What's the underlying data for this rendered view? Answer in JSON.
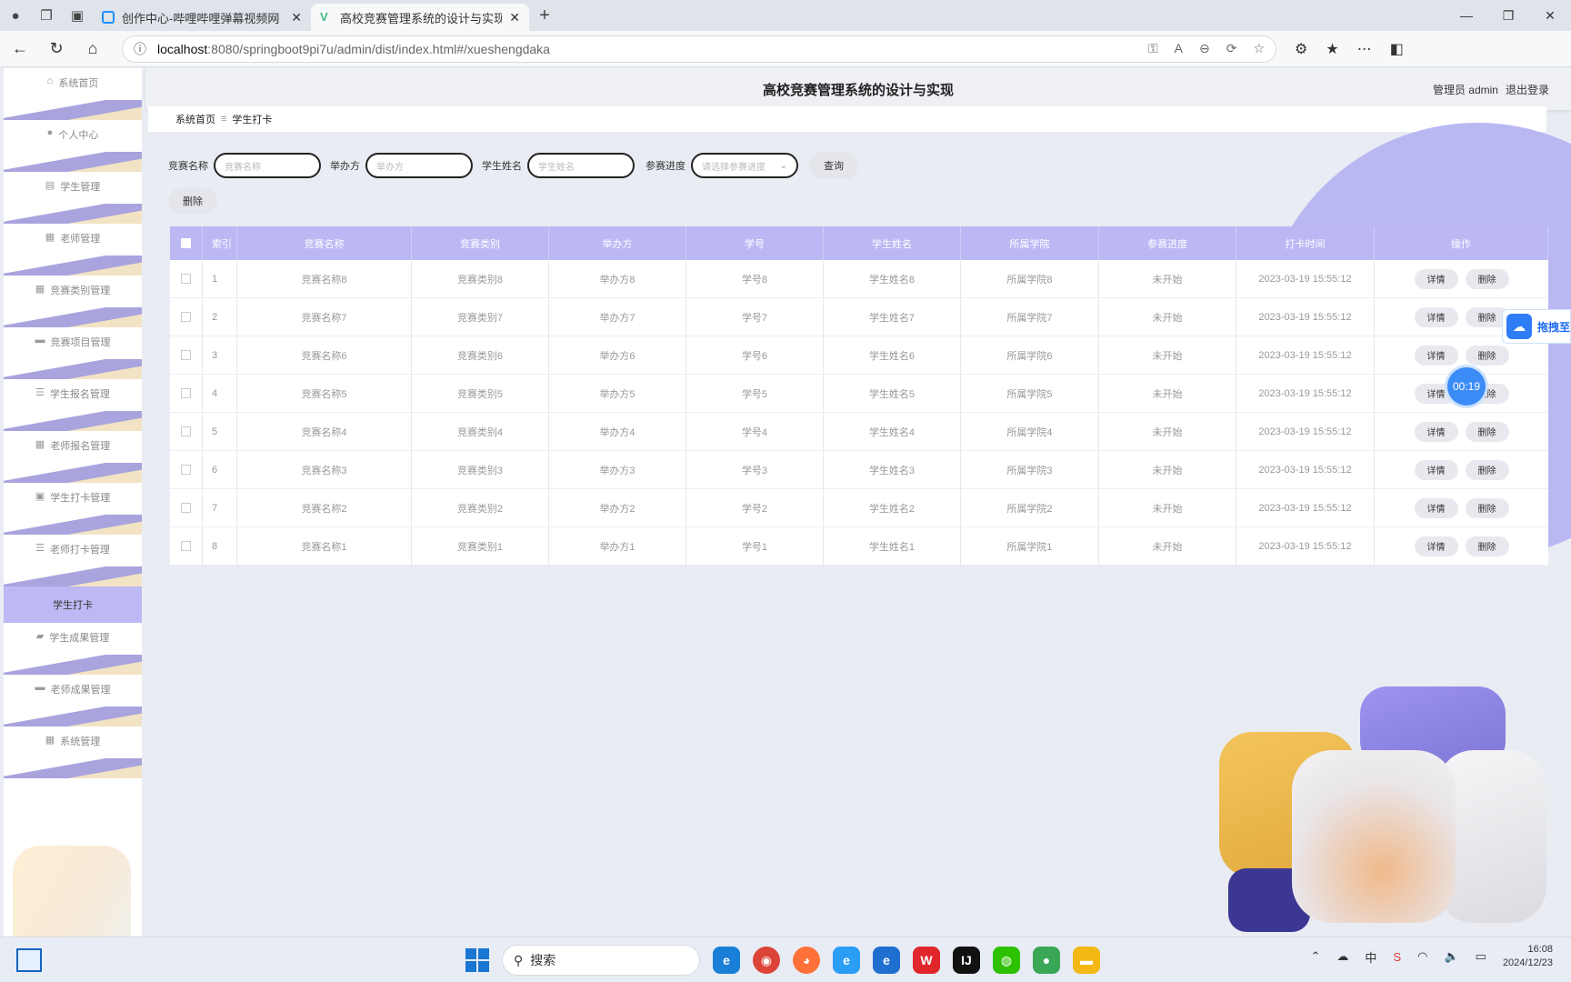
{
  "browser": {
    "tabs": [
      {
        "label": "创作中心-哔哩哔哩弹幕视频网",
        "active": false
      },
      {
        "label": "高校竞赛管理系统的设计与实现",
        "active": true
      }
    ],
    "url_host": "localhost",
    "url_path": ":8080/springboot9pi7u/admin/dist/index.html#/xueshengdaka"
  },
  "header": {
    "title": "高校竞赛管理系统的设计与实现",
    "user_label": "管理员 admin",
    "logout": "退出登录"
  },
  "sidebar": {
    "items": [
      {
        "label": "系统首页",
        "icon": "home-icon",
        "active": false
      },
      {
        "label": "个人中心",
        "icon": "user-icon",
        "active": false
      },
      {
        "label": "学生管理",
        "icon": "doc-icon",
        "active": false
      },
      {
        "label": "老师管理",
        "icon": "grid-icon",
        "active": false
      },
      {
        "label": "竞赛类别管理",
        "icon": "grid-icon",
        "active": false
      },
      {
        "label": "竞赛项目管理",
        "icon": "chat-icon",
        "active": false
      },
      {
        "label": "学生报名管理",
        "icon": "list-icon",
        "active": false
      },
      {
        "label": "老师报名管理",
        "icon": "grid-icon",
        "active": false
      },
      {
        "label": "学生打卡管理",
        "icon": "clip-icon",
        "active": false
      },
      {
        "label": "老师打卡管理",
        "icon": "list-icon",
        "active": false
      },
      {
        "label": "学生打卡",
        "icon": "",
        "active": true
      },
      {
        "label": "学生成果管理",
        "icon": "thumb-icon",
        "active": false
      },
      {
        "label": "老师成果管理",
        "icon": "chat-icon",
        "active": false
      },
      {
        "label": "系统管理",
        "icon": "grid-icon",
        "active": false
      }
    ]
  },
  "breadcrumb": {
    "home": "系统首页",
    "sep": "≡",
    "current": "学生打卡"
  },
  "search": {
    "fields": [
      {
        "label": "竞赛名称",
        "placeholder": "竞赛名称"
      },
      {
        "label": "举办方",
        "placeholder": "举办方"
      },
      {
        "label": "学生姓名",
        "placeholder": "学生姓名"
      }
    ],
    "select_label": "参赛进度",
    "select_placeholder": "请选择参赛进度",
    "query_button": "查询",
    "delete_button": "删除"
  },
  "table": {
    "columns": [
      "索引",
      "竞赛名称",
      "竞赛类别",
      "举办方",
      "学号",
      "学生姓名",
      "所属学院",
      "参赛进度",
      "打卡时间",
      "操作"
    ],
    "detail_label": "详情",
    "delete_label": "删除",
    "rows": [
      [
        "1",
        "竞赛名称8",
        "竞赛类别8",
        "举办方8",
        "学号8",
        "学生姓名8",
        "所属学院8",
        "未开始",
        "2023-03-19 15:55:12"
      ],
      [
        "2",
        "竞赛名称7",
        "竞赛类别7",
        "举办方7",
        "学号7",
        "学生姓名7",
        "所属学院7",
        "未开始",
        "2023-03-19 15:55:12"
      ],
      [
        "3",
        "竞赛名称6",
        "竞赛类别6",
        "举办方6",
        "学号6",
        "学生姓名6",
        "所属学院6",
        "未开始",
        "2023-03-19 15:55:12"
      ],
      [
        "4",
        "竞赛名称5",
        "竞赛类别5",
        "举办方5",
        "学号5",
        "学生姓名5",
        "所属学院5",
        "未开始",
        "2023-03-19 15:55:12"
      ],
      [
        "5",
        "竞赛名称4",
        "竞赛类别4",
        "举办方4",
        "学号4",
        "学生姓名4",
        "所属学院4",
        "未开始",
        "2023-03-19 15:55:12"
      ],
      [
        "6",
        "竞赛名称3",
        "竞赛类别3",
        "举办方3",
        "学号3",
        "学生姓名3",
        "所属学院3",
        "未开始",
        "2023-03-19 15:55:12"
      ],
      [
        "7",
        "竞赛名称2",
        "竞赛类别2",
        "举办方2",
        "学号2",
        "学生姓名2",
        "所属学院2",
        "未开始",
        "2023-03-19 15:55:12"
      ],
      [
        "8",
        "竞赛名称1",
        "竞赛类别1",
        "举办方1",
        "学号1",
        "学生姓名1",
        "所属学院1",
        "未开始",
        "2023-03-19 15:55:12"
      ]
    ]
  },
  "overlay": {
    "timer": "00:19",
    "drag_label": "拖拽至"
  },
  "taskbar": {
    "search_placeholder": "搜索",
    "ime": "中",
    "time": "16:08",
    "date": "2024/12/23"
  }
}
